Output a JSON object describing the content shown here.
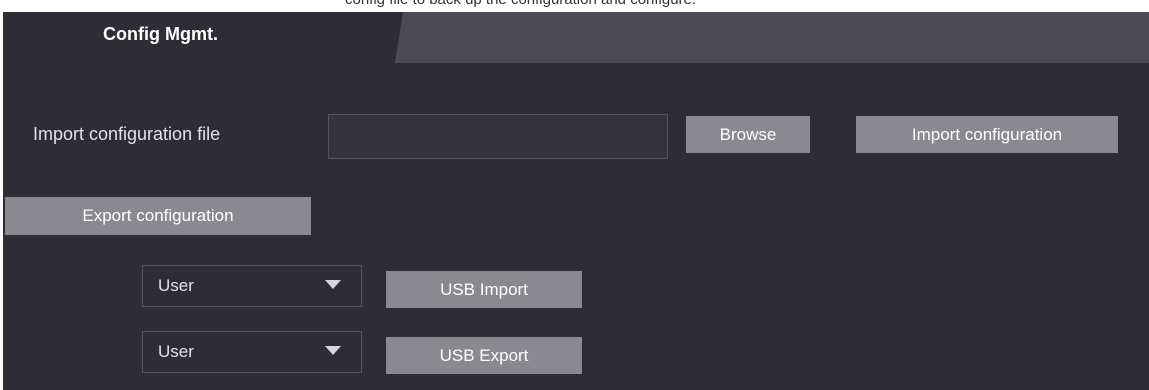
{
  "top_strip_text": "config file to back up the configuration and configure.",
  "tab": {
    "label": "Config Mgmt."
  },
  "import": {
    "label": "Import configuration file",
    "file_value": "",
    "browse_label": "Browse",
    "import_label": "Import configuration"
  },
  "export": {
    "label": "Export configuration"
  },
  "usb": {
    "import_select_value": "User",
    "import_button": "USB Import",
    "export_select_value": "User",
    "export_button": "USB Export"
  },
  "colors": {
    "panel_bg": "#2e2d36",
    "tabbar_bg": "#4b4a55",
    "button_bg": "#8a898f",
    "text": "#e2e2e6"
  },
  "icons": {
    "dropdown": "caret-down-icon"
  }
}
